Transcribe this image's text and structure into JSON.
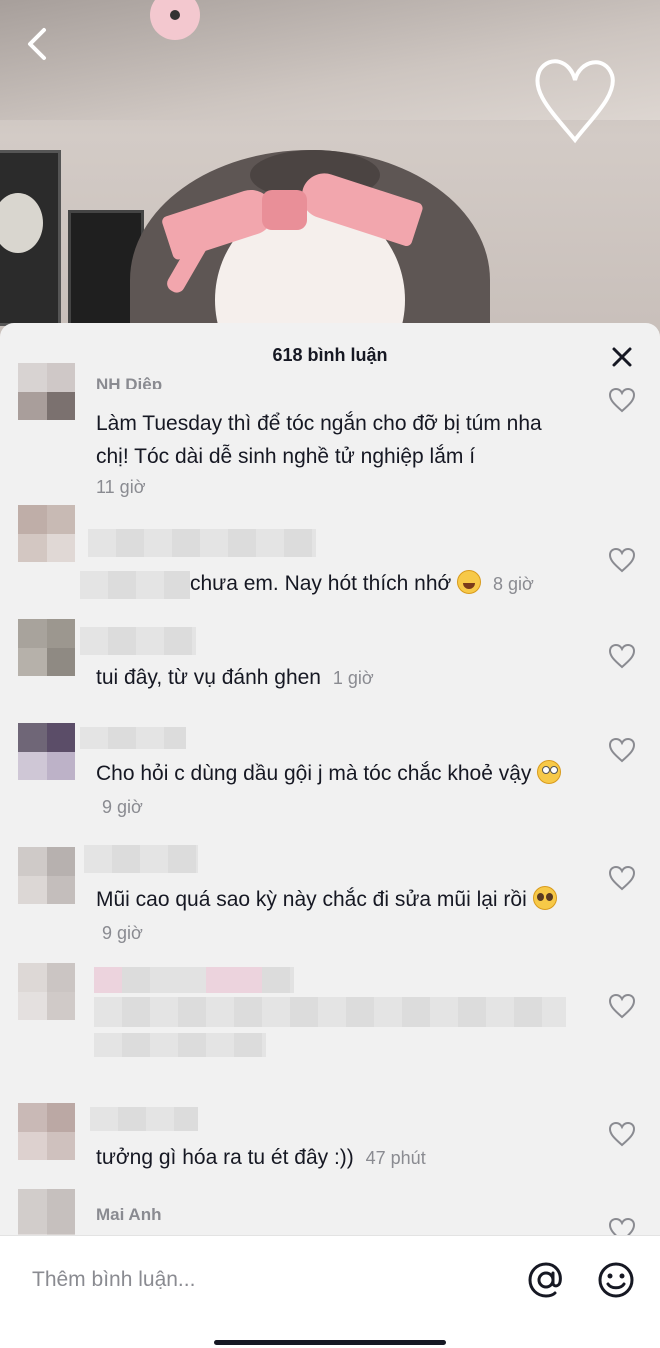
{
  "header": {
    "title": "618 bình luận"
  },
  "comments": [
    {
      "username": "NH Diệp",
      "text": "Làm Tuesday thì để tóc ngắn cho đỡ bị túm nha chị! Tóc dài dễ sinh nghề tử nghiệp lắm í",
      "time": "11 giờ"
    },
    {
      "username": "",
      "text": "chưa em. Nay hót thích nhớ",
      "emoji": "laugh",
      "time": "8 giờ"
    },
    {
      "username": "",
      "text": "tui đây, từ vụ đánh ghen",
      "time": "1 giờ"
    },
    {
      "username": "",
      "text": "Cho hỏi c dùng dầu gội j mà tóc chắc khoẻ vậy",
      "emoji": "roll",
      "time": "9 giờ"
    },
    {
      "username": "",
      "text": "Mũi cao quá sao kỳ này chắc đi sửa mũi lại rồi",
      "emoji": "plead",
      "time": "9 giờ"
    },
    {
      "username": "",
      "text": "",
      "time": ""
    },
    {
      "username": "",
      "text": "tưởng gì hóa ra tu ét đây :))",
      "time": "47 phút"
    },
    {
      "username": "Mai Anh",
      "text": "",
      "time": ""
    }
  ],
  "input": {
    "placeholder": "Thêm bình luận..."
  },
  "icons": {
    "back": "chevron-left-icon",
    "close": "close-icon",
    "like": "heart-outline-icon",
    "mention": "at-sign-icon",
    "emoji": "smiley-icon"
  },
  "colors": {
    "text": "#161823",
    "secondary": "#8a8b91",
    "sheet": "#f1f1f1"
  }
}
